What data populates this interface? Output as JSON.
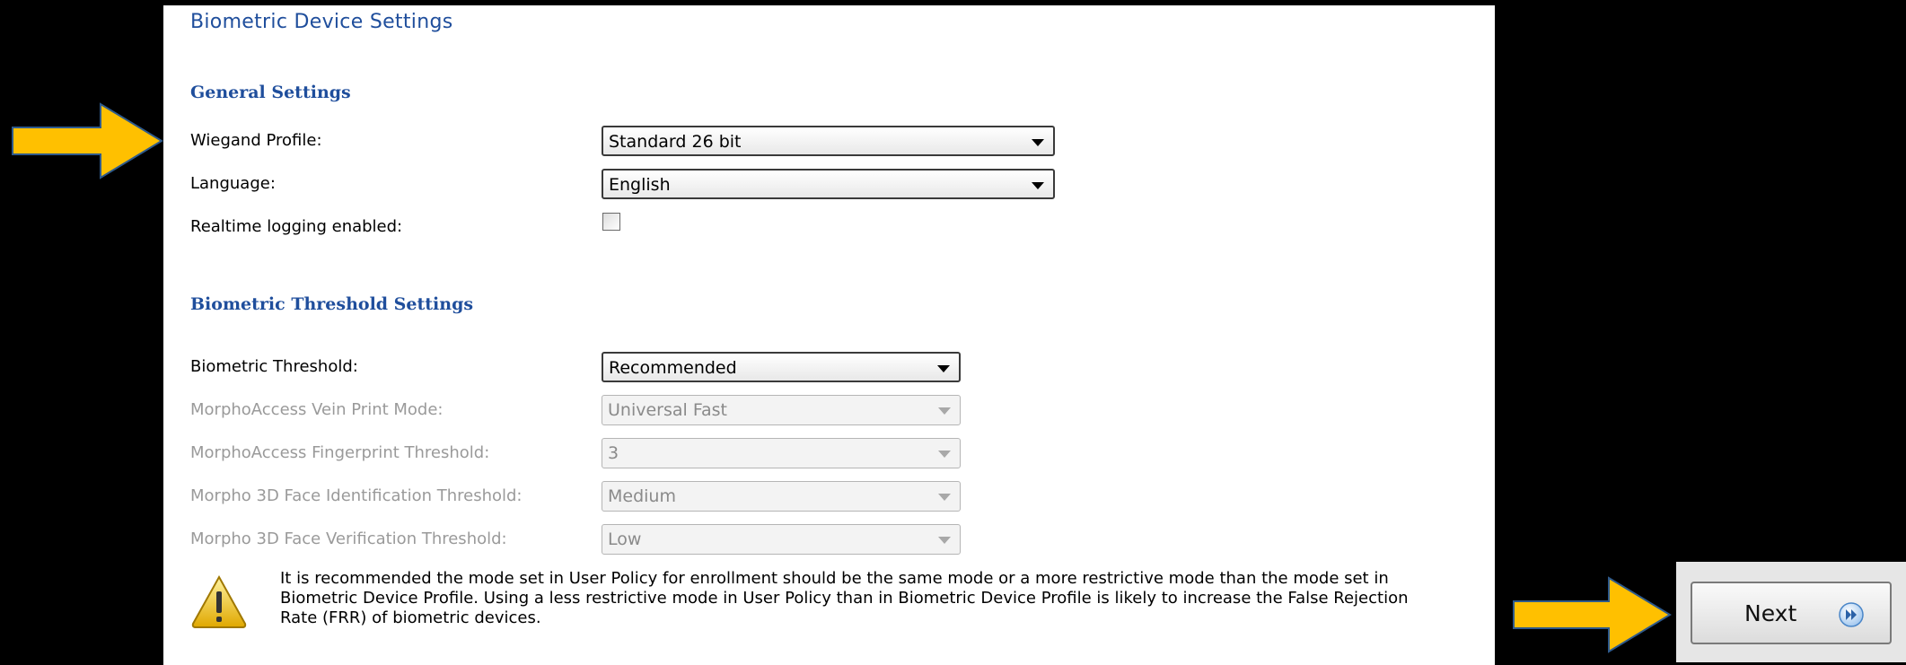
{
  "page": {
    "title": "Biometric Device Settings"
  },
  "general": {
    "heading": "General Settings",
    "wiegand_label": "Wiegand Profile:",
    "wiegand_value": "Standard 26 bit",
    "language_label": "Language:",
    "language_value": "English",
    "realtime_label": "Realtime logging enabled:",
    "realtime_checked": false
  },
  "threshold": {
    "heading": "Biometric Threshold Settings",
    "biometric_label": "Biometric Threshold:",
    "biometric_value": "Recommended",
    "vein_label": "MorphoAccess Vein Print Mode:",
    "vein_value": "Universal Fast",
    "fingerprint_label": "MorphoAccess Fingerprint Threshold:",
    "fingerprint_value": "3",
    "face_id_label": "Morpho 3D Face Identification Threshold:",
    "face_id_value": "Medium",
    "face_verify_label": "Morpho 3D Face Verification Threshold:",
    "face_verify_value": "Low"
  },
  "warning": {
    "icon": "warning-triangle-icon",
    "text": "It is recommended the mode set in User Policy for enrollment should be the same mode or a more restrictive mode than the mode set in Biometric Device Profile.  Using a less restrictive mode in User Policy than in Biometric Device Profile is likely to increase the False Rejection Rate (FRR) of biometric devices."
  },
  "footer": {
    "next_label": "Next",
    "next_icon": "fast-forward-icon"
  },
  "colors": {
    "heading_blue": "#1f4e9c",
    "arrow_yellow": "#ffc000",
    "arrow_outline": "#2e5a8c"
  }
}
